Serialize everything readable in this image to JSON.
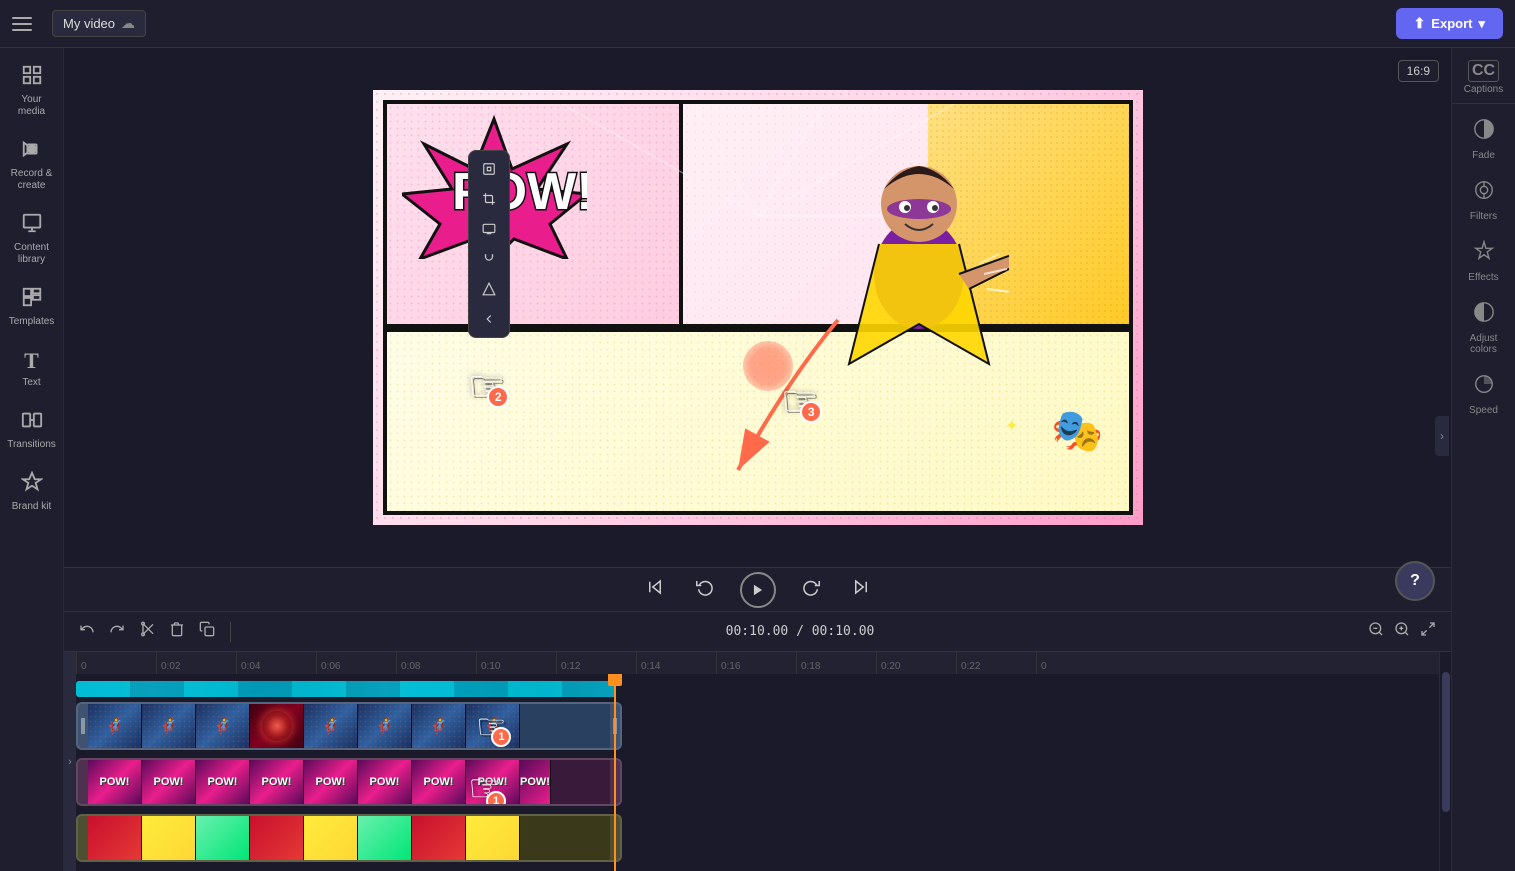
{
  "topbar": {
    "menu_label": "Menu",
    "title": "My video",
    "export_label": "Export"
  },
  "left_sidebar": {
    "items": [
      {
        "id": "your-media",
        "icon": "⬜",
        "label": "Your media"
      },
      {
        "id": "record",
        "icon": "🎥",
        "label": "Record"
      },
      {
        "id": "content-library",
        "icon": "📚",
        "label": "Content library"
      },
      {
        "id": "templates",
        "icon": "⬛",
        "label": "Templates"
      },
      {
        "id": "text",
        "icon": "T",
        "label": "Text"
      },
      {
        "id": "transitions",
        "icon": "↔",
        "label": "Transitions"
      },
      {
        "id": "brand-kit",
        "icon": "✦",
        "label": "Brand kit"
      }
    ]
  },
  "right_sidebar": {
    "captions_label": "Captions",
    "items": [
      {
        "id": "fade",
        "icon": "◐",
        "label": "Fade"
      },
      {
        "id": "filters",
        "icon": "◎",
        "label": "Filters"
      },
      {
        "id": "effects",
        "icon": "✏",
        "label": "Effects"
      },
      {
        "id": "adjust-colors",
        "icon": "◑",
        "label": "Adjust colors"
      },
      {
        "id": "speed",
        "icon": "◔",
        "label": "Speed"
      }
    ]
  },
  "video_preview": {
    "aspect_ratio": "16:9"
  },
  "floating_toolbar": {
    "tools": [
      {
        "id": "pin",
        "icon": "⊞"
      },
      {
        "id": "crop",
        "icon": "⌷"
      },
      {
        "id": "screen",
        "icon": "▣"
      },
      {
        "id": "circle",
        "icon": "⊙"
      },
      {
        "id": "triangle",
        "icon": "▲"
      },
      {
        "id": "arrow-left",
        "icon": "◁"
      }
    ]
  },
  "controls": {
    "skip_back": "⏮",
    "rewind": "↺",
    "play": "▶",
    "forward": "↻",
    "skip_forward": "⏭",
    "fullscreen": "⛶"
  },
  "timeline": {
    "toolbar": {
      "undo": "↩",
      "redo": "↪",
      "cut": "✂",
      "delete": "🗑",
      "copy": "⧉"
    },
    "time_display": "00:10.00 / 00:10.00",
    "zoom_out": "−",
    "zoom_in": "+",
    "expand": "⤢",
    "ruler_marks": [
      "0",
      "0:02",
      "0:04",
      "0:06",
      "0:08",
      "0:10",
      "0:12",
      "0:14",
      "0:16",
      "0:18",
      "0:20",
      "0:22",
      "0"
    ]
  },
  "help": {
    "label": "?"
  },
  "hand_cursors": [
    {
      "id": "hand-1",
      "number": "1",
      "description": "timeline track hand"
    },
    {
      "id": "hand-2",
      "number": "2",
      "description": "video lower-left hand"
    },
    {
      "id": "hand-3",
      "number": "3",
      "description": "video center-right hand"
    }
  ]
}
